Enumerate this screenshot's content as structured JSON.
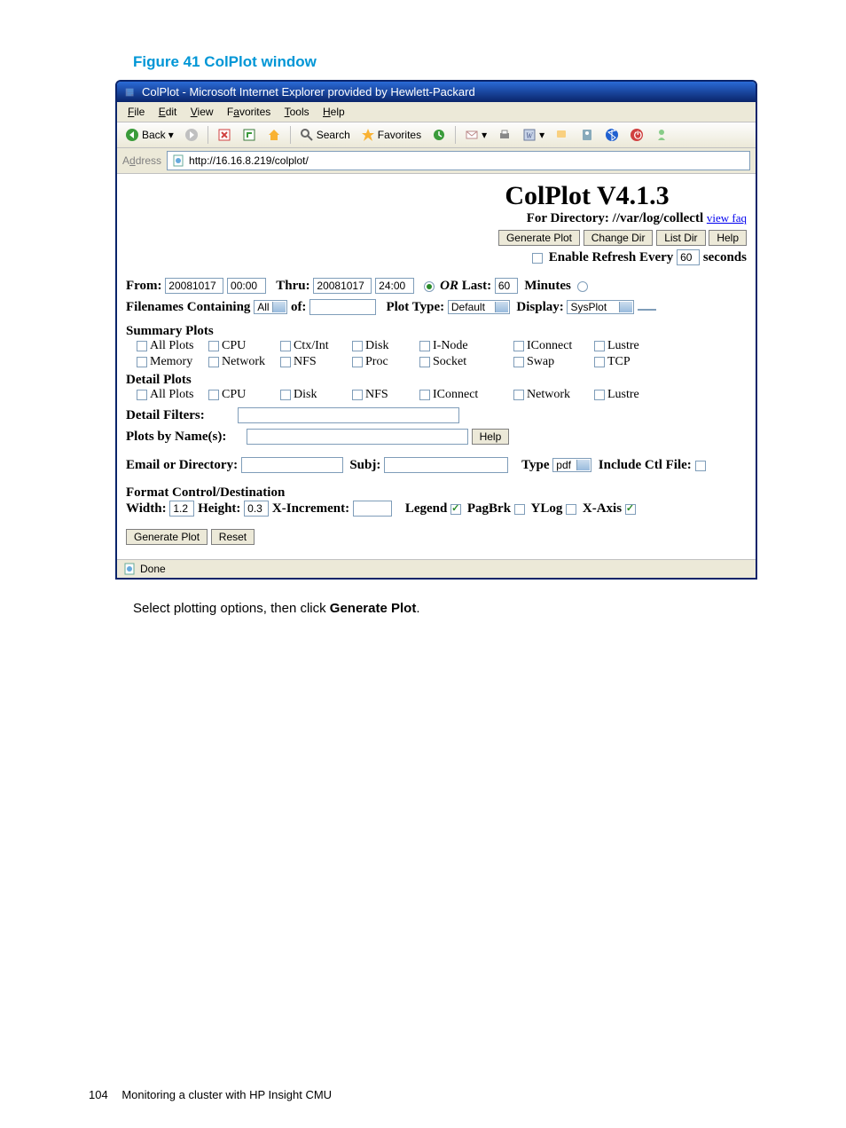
{
  "figure_title": "Figure 41 ColPlot window",
  "window_title": "ColPlot - Microsoft Internet Explorer provided by Hewlett-Packard",
  "menus": {
    "file": "File",
    "edit": "Edit",
    "view": "View",
    "favorites": "Favorites",
    "tools": "Tools",
    "help": "Help"
  },
  "toolbar": {
    "back": "Back",
    "search": "Search",
    "favorites": "Favorites"
  },
  "address": {
    "label": "Address",
    "url": "http://16.16.8.219/colplot/"
  },
  "header": {
    "title": "ColPlot V4.1.3",
    "subtitle": "For Directory: //var/log/collectl",
    "faq": "view faq",
    "btn_gen": "Generate Plot",
    "btn_ch": "Change Dir",
    "btn_list": "List Dir",
    "btn_help": "Help",
    "refresh_label": "Enable Refresh Every",
    "refresh_val": "60",
    "seconds": "seconds"
  },
  "range": {
    "from": "From:",
    "from_date": "20081017",
    "from_time": "00:00",
    "thru": "Thru:",
    "thru_date": "20081017",
    "thru_time": "24:00",
    "or": "OR",
    "last": "Last:",
    "last_val": "60",
    "minutes": "Minutes"
  },
  "filter": {
    "files": "Filenames Containing",
    "all": "All",
    "of": "of:",
    "plot_type": "Plot Type:",
    "plot_type_val": "Default",
    "display": "Display:",
    "display_val": "SysPlot"
  },
  "summary": {
    "title": "Summary Plots",
    "r1": [
      "All Plots",
      "CPU",
      "Ctx/Int",
      "Disk",
      "I-Node",
      "IConnect",
      "Lustre"
    ],
    "r2": [
      "Memory",
      "Network",
      "NFS",
      "Proc",
      "Socket",
      "Swap",
      "TCP"
    ]
  },
  "detail": {
    "title": "Detail Plots",
    "r": [
      "All Plots",
      "CPU",
      "Disk",
      "NFS",
      "IConnect",
      "Network",
      "Lustre"
    ],
    "filters": "Detail Filters:",
    "names": "Plots by Name(s):",
    "help": "Help"
  },
  "email": {
    "label": "Email or Directory:",
    "subj": "Subj:",
    "type": "Type",
    "type_val": "pdf",
    "include": "Include Ctl File:"
  },
  "format": {
    "title": "Format Control/Destination",
    "width": "Width:",
    "width_val": "1.2",
    "height": "Height:",
    "height_val": "0.3",
    "xinc": "X-Increment:",
    "legend": "Legend",
    "pagbrk": "PagBrk",
    "ylog": "YLog",
    "xaxis": "X-Axis"
  },
  "submit": {
    "gen": "Generate Plot",
    "reset": "Reset"
  },
  "status": "Done",
  "caption_pre": "Select plotting options, then click ",
  "caption_bold": "Generate Plot",
  "caption_post": ".",
  "footer": {
    "page": "104",
    "text": "Monitoring a cluster with HP Insight CMU"
  }
}
